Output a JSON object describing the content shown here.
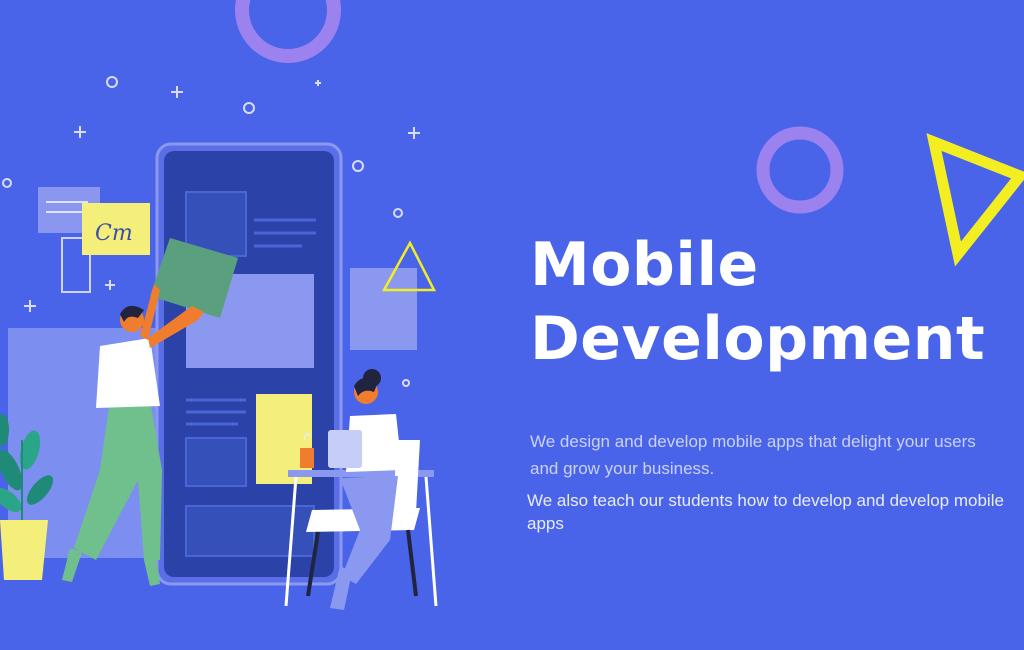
{
  "hero": {
    "title_line1": "Mobile",
    "title_line2": "Development",
    "description": "We design and develop mobile apps that delight your users and grow your business.",
    "description_secondary": "We also teach our students how to develop and develop mobile apps",
    "signature_text": "Cm"
  },
  "colors": {
    "background": "#4a64e9",
    "accent_yellow": "#f2ee21",
    "accent_purple": "#9b82ee",
    "phone_body": "#2b43a8",
    "text_primary": "#ffffff"
  },
  "icons": {
    "triangle_outline": "triangle-icon",
    "ring": "ring-icon",
    "plus": "plus-icon",
    "plant": "plant-icon"
  }
}
